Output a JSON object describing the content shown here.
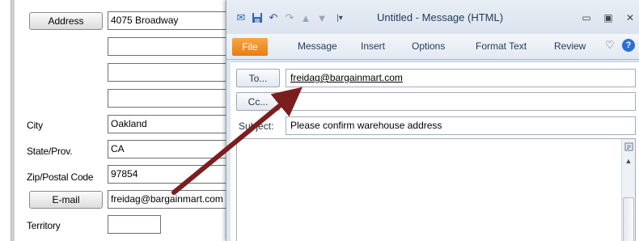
{
  "contact_form": {
    "address_button": "Address",
    "address_lines": [
      "4075 Broadway",
      "",
      "",
      ""
    ],
    "city_label": "City",
    "city_value": "Oakland",
    "state_label": "State/Prov.",
    "state_value": "CA",
    "zip_label": "Zip/Postal Code",
    "zip_value": "97854",
    "email_button": "E-mail",
    "email_value": "freidag@bargainmart.com",
    "territory_label": "Territory",
    "territory_value": ""
  },
  "message_window": {
    "title": "Untitled - Message (HTML)",
    "quick_access_icons": [
      "outlook-icon",
      "save-icon",
      "undo-icon",
      "redo-icon",
      "up-arrow-icon",
      "down-arrow-icon",
      "customize-toolbar-icon"
    ],
    "window_controls": {
      "minimize": "▭",
      "restore": "▣",
      "close": "✕"
    },
    "tabs": [
      "File",
      "Message",
      "Insert",
      "Options",
      "Format Text",
      "Review"
    ],
    "to_button": "To...",
    "to_value": "freidag@bargainmart.com",
    "cc_button": "Cc...",
    "cc_value": "",
    "subject_label": "Subject:",
    "subject_value": "Please confirm warehouse address",
    "body_value": ""
  },
  "colors": {
    "arrow": "#7b1e1e",
    "file_tab": "#e98a1f",
    "title_text": "#1e395b"
  }
}
